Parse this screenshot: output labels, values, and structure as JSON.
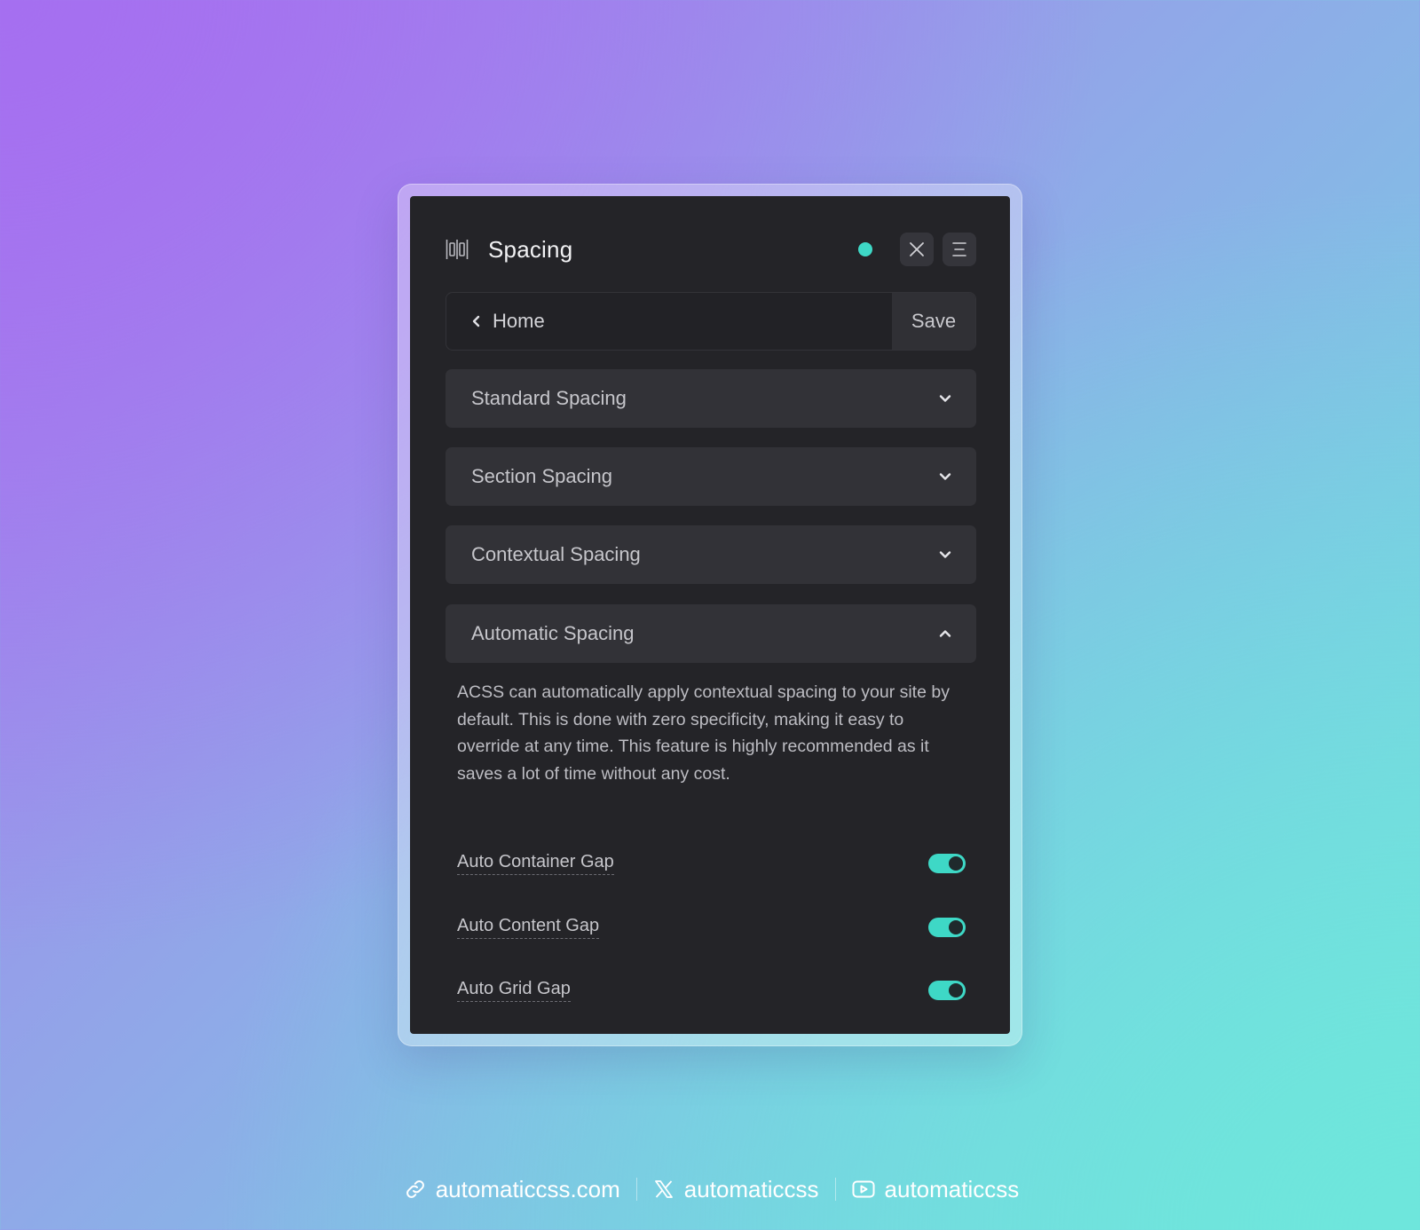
{
  "panel": {
    "title": "Spacing",
    "status_color": "#3ed8c6",
    "icons": {
      "title": "spacing-icon",
      "close": "close-icon",
      "menu": "menu-icon"
    }
  },
  "nav": {
    "back_label": "Home",
    "save_label": "Save"
  },
  "accordions": [
    {
      "label": "Standard Spacing",
      "expanded": false
    },
    {
      "label": "Section Spacing",
      "expanded": false
    },
    {
      "label": "Contextual Spacing",
      "expanded": false
    },
    {
      "label": "Automatic Spacing",
      "expanded": true
    }
  ],
  "automatic_spacing": {
    "description": "ACSS can automatically apply contextual spacing to your site by default. This is done with zero specificity, making it easy to override at any time. This feature is highly recommended as it saves a lot of time without any cost.",
    "toggles": [
      {
        "label": "Auto Container Gap",
        "on": true
      },
      {
        "label": "Auto Content Gap",
        "on": true
      },
      {
        "label": "Auto Grid Gap",
        "on": true
      }
    ]
  },
  "footer": {
    "website": "automaticcss.com",
    "x_handle": "automaticcss",
    "youtube_handle": "automaticcss"
  },
  "colors": {
    "accent": "#3ed8c6",
    "panel_bg": "#242428",
    "accordion_bg": "#323237"
  }
}
